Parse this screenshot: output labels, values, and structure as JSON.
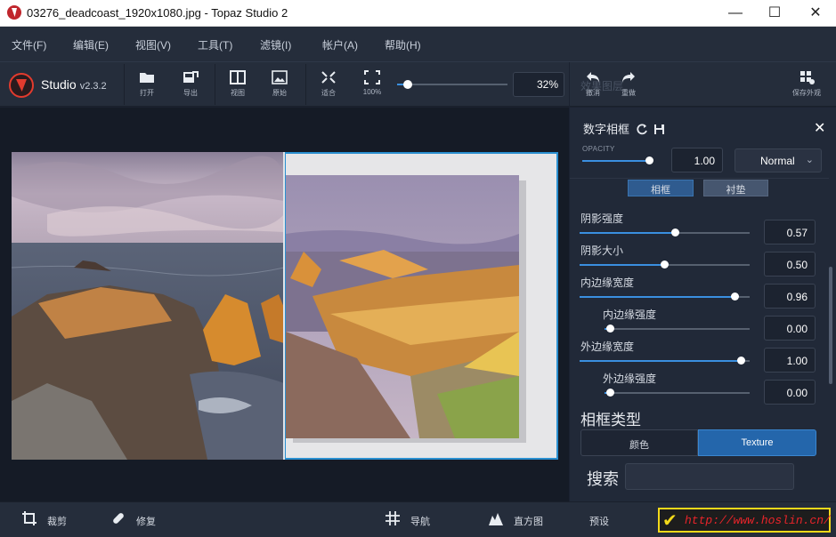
{
  "window": {
    "title": "03276_deadcoast_1920x1080.jpg - Topaz Studio 2",
    "minimize": "—",
    "maximize": "☐",
    "close": "✕"
  },
  "menu": [
    "文件(F)",
    "编辑(E)",
    "视图(V)",
    "工具(T)",
    "滤镜(I)",
    "帐户(A)",
    "帮助(H)"
  ],
  "brand": {
    "name": "Studio",
    "version": "v2.3.2"
  },
  "toolbar": {
    "open": "打开",
    "export": "导出",
    "view": "视图",
    "original": "原始",
    "fit": "适合",
    "zoom100": "100%",
    "zoom_value": "32%",
    "zoom_level_fraction": 0.1,
    "ghost_text": "效果图层",
    "undo": "撤消",
    "redo": "重做",
    "save_look": "保存外观"
  },
  "panel": {
    "title": "数字相框",
    "close": "✕",
    "opacity_label": "OPACITY",
    "opacity_value": "1.00",
    "opacity_level": 1.0,
    "blend_mode": "Normal",
    "tabs": [
      "相框",
      "衬垫"
    ],
    "sliders": [
      {
        "label": "阴影强度",
        "value": "0.57",
        "level": 0.57
      },
      {
        "label": "阴影大小",
        "value": "0.50",
        "level": 0.5
      },
      {
        "label": "内边缘宽度",
        "value": "0.96",
        "level": 0.96
      },
      {
        "label": "内边缘强度",
        "value": "0.00",
        "level": 0.0
      },
      {
        "label": "外边缘宽度",
        "value": "1.00",
        "level": 1.0
      },
      {
        "label": "外边缘强度",
        "value": "0.00",
        "level": 0.0
      }
    ],
    "frame_type_title": "相框类型",
    "frame_types": [
      "颜色",
      "Texture"
    ],
    "frame_type_selected": "Texture",
    "search_label": "搜索",
    "search_value": ""
  },
  "bottom": {
    "crop": "裁剪",
    "repair": "修复",
    "navigate": "导航",
    "histogram": "直方图",
    "presets": "预设"
  },
  "watermark": {
    "check": "✔",
    "url": "http://www.hoslin.cn/"
  },
  "colors": {
    "accent": "#2a8fd0",
    "panel_bg": "#212938",
    "toolbar_bg": "#252d3b",
    "canvas_bg": "#151b26"
  }
}
